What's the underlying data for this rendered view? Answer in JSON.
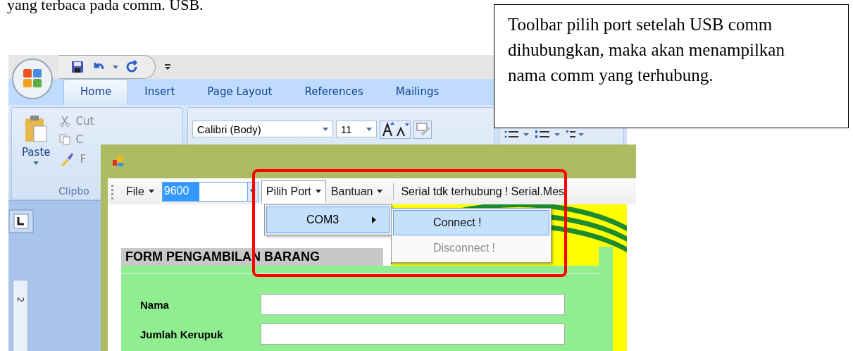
{
  "document_text": "yang terbaca pada comm. USB.",
  "callout": "Toolbar pilih port setelah USB comm dihubungkan, maka akan menampilkan nama comm yang terhubung.",
  "word": {
    "tabs": [
      {
        "label": "Home",
        "selected": true
      },
      {
        "label": "Insert",
        "selected": false
      },
      {
        "label": "Page Layout",
        "selected": false
      },
      {
        "label": "References",
        "selected": false
      },
      {
        "label": "Mailings",
        "selected": false
      }
    ],
    "clipboard": {
      "paste": "Paste",
      "cut": "Cut",
      "copy": "C",
      "format": "F",
      "label": "Clipbo"
    },
    "font": {
      "name": "Calibri (Body)",
      "size": "11"
    },
    "ruler_mark": "2"
  },
  "app": {
    "toolbar": {
      "file": "File",
      "baud": {
        "value": "9600",
        "highlighted": true
      },
      "menus": [
        {
          "label": "Pilih Port",
          "open": true
        },
        {
          "label": "Bantuan",
          "open": false
        }
      ],
      "status": "Serial tdk terhubung !",
      "message": "Serial.Mes"
    },
    "port_menu": [
      {
        "label": "COM3",
        "selected": true
      }
    ],
    "port_submenu": [
      {
        "label": "Connect !",
        "selected": true,
        "disabled": false
      },
      {
        "label": "Disconnect !",
        "selected": false,
        "disabled": true
      }
    ],
    "form": {
      "title": "FORM PENGAMBILAN BARANG",
      "fields": [
        {
          "label": "Nama"
        },
        {
          "label": "Jumlah Kerupuk"
        }
      ]
    }
  }
}
